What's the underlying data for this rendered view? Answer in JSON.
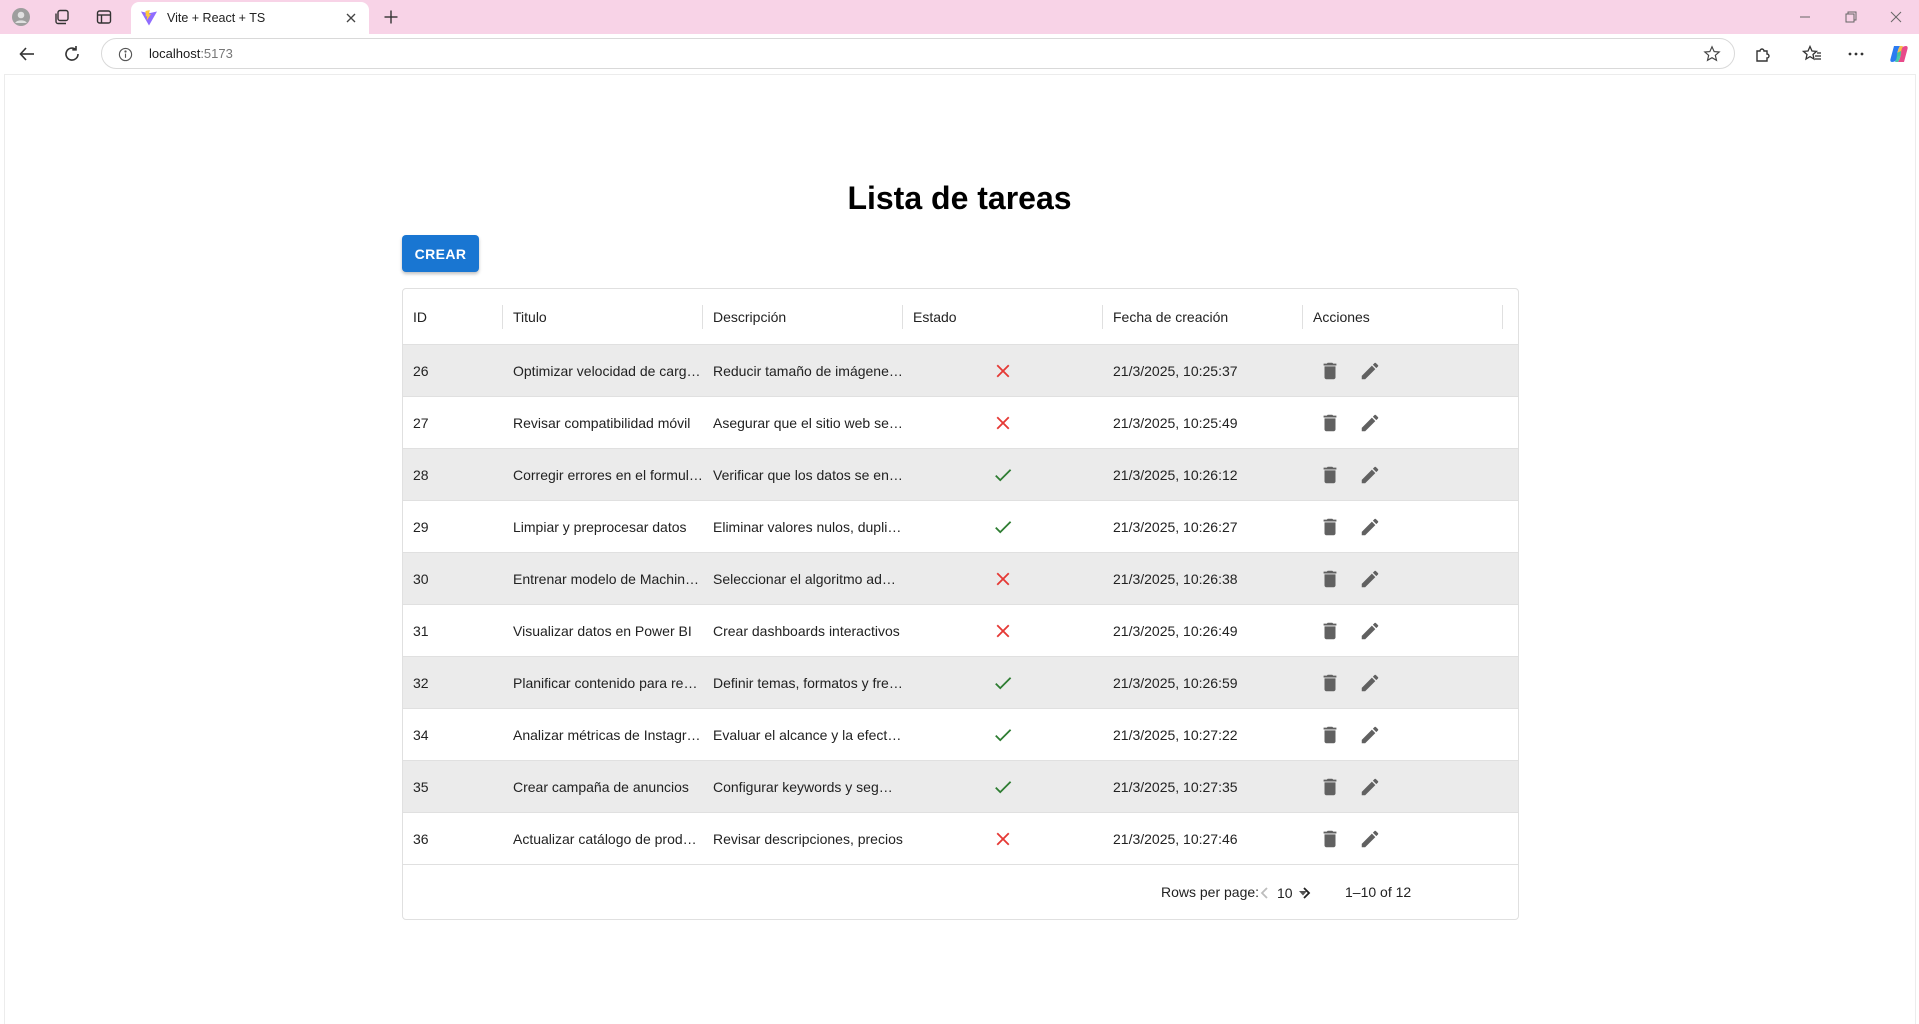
{
  "browser": {
    "tab_title": "Vite + React + TS",
    "url_host": "localhost",
    "url_port": ":5173"
  },
  "page": {
    "title": "Lista de tareas",
    "create_label": "CREAR"
  },
  "table": {
    "columns": [
      "ID",
      "Titulo",
      "Descripción",
      "Estado",
      "Fecha de creación",
      "Acciones"
    ],
    "rows": [
      {
        "id": "26",
        "title": "Optimizar velocidad de carga del sitio",
        "desc": "Reducir tamaño de imágenes y scripts",
        "done": false,
        "date": "21/3/2025, 10:25:37"
      },
      {
        "id": "27",
        "title": "Revisar compatibilidad móvil",
        "desc": "Asegurar que el sitio web se vea bien",
        "done": false,
        "date": "21/3/2025, 10:25:49"
      },
      {
        "id": "28",
        "title": "Corregir errores en el formulario",
        "desc": "Verificar que los datos se envíen",
        "done": true,
        "date": "21/3/2025, 10:26:12"
      },
      {
        "id": "29",
        "title": "Limpiar y preprocesar datos",
        "desc": "Eliminar valores nulos, duplicados",
        "done": true,
        "date": "21/3/2025, 10:26:27"
      },
      {
        "id": "30",
        "title": "Entrenar modelo de Machine Learning",
        "desc": "Seleccionar el algoritmo adecuado",
        "done": false,
        "date": "21/3/2025, 10:26:38"
      },
      {
        "id": "31",
        "title": "Visualizar datos en Power BI",
        "desc": "Crear dashboards interactivos",
        "done": false,
        "date": "21/3/2025, 10:26:49"
      },
      {
        "id": "32",
        "title": "Planificar contenido para redes",
        "desc": "Definir temas, formatos y frecuencia",
        "done": true,
        "date": "21/3/2025, 10:26:59"
      },
      {
        "id": "34",
        "title": "Analizar métricas de Instagram",
        "desc": "Evaluar el alcance y la efectividad",
        "done": true,
        "date": "21/3/2025, 10:27:22"
      },
      {
        "id": "35",
        "title": "Crear campaña de anuncios",
        "desc": "Configurar keywords y segmentación",
        "done": true,
        "date": "21/3/2025, 10:27:35"
      },
      {
        "id": "36",
        "title": "Actualizar catálogo de productos",
        "desc": "Revisar descripciones, precios",
        "done": false,
        "date": "21/3/2025, 10:27:46"
      }
    ]
  },
  "pagination": {
    "rows_per_page_label": "Rows per page:",
    "rows_per_page_value": "10",
    "range_text": "1–10 of 12"
  },
  "colors": {
    "accent": "#1976d2",
    "done": "#2e7d32",
    "not_done": "#e53935",
    "icon_gray": "#616161",
    "titlebar": "#f8d3e7"
  },
  "icons": {
    "done": "check-icon",
    "not_done": "close-icon",
    "delete": "trash-icon",
    "edit": "pencil-icon"
  }
}
